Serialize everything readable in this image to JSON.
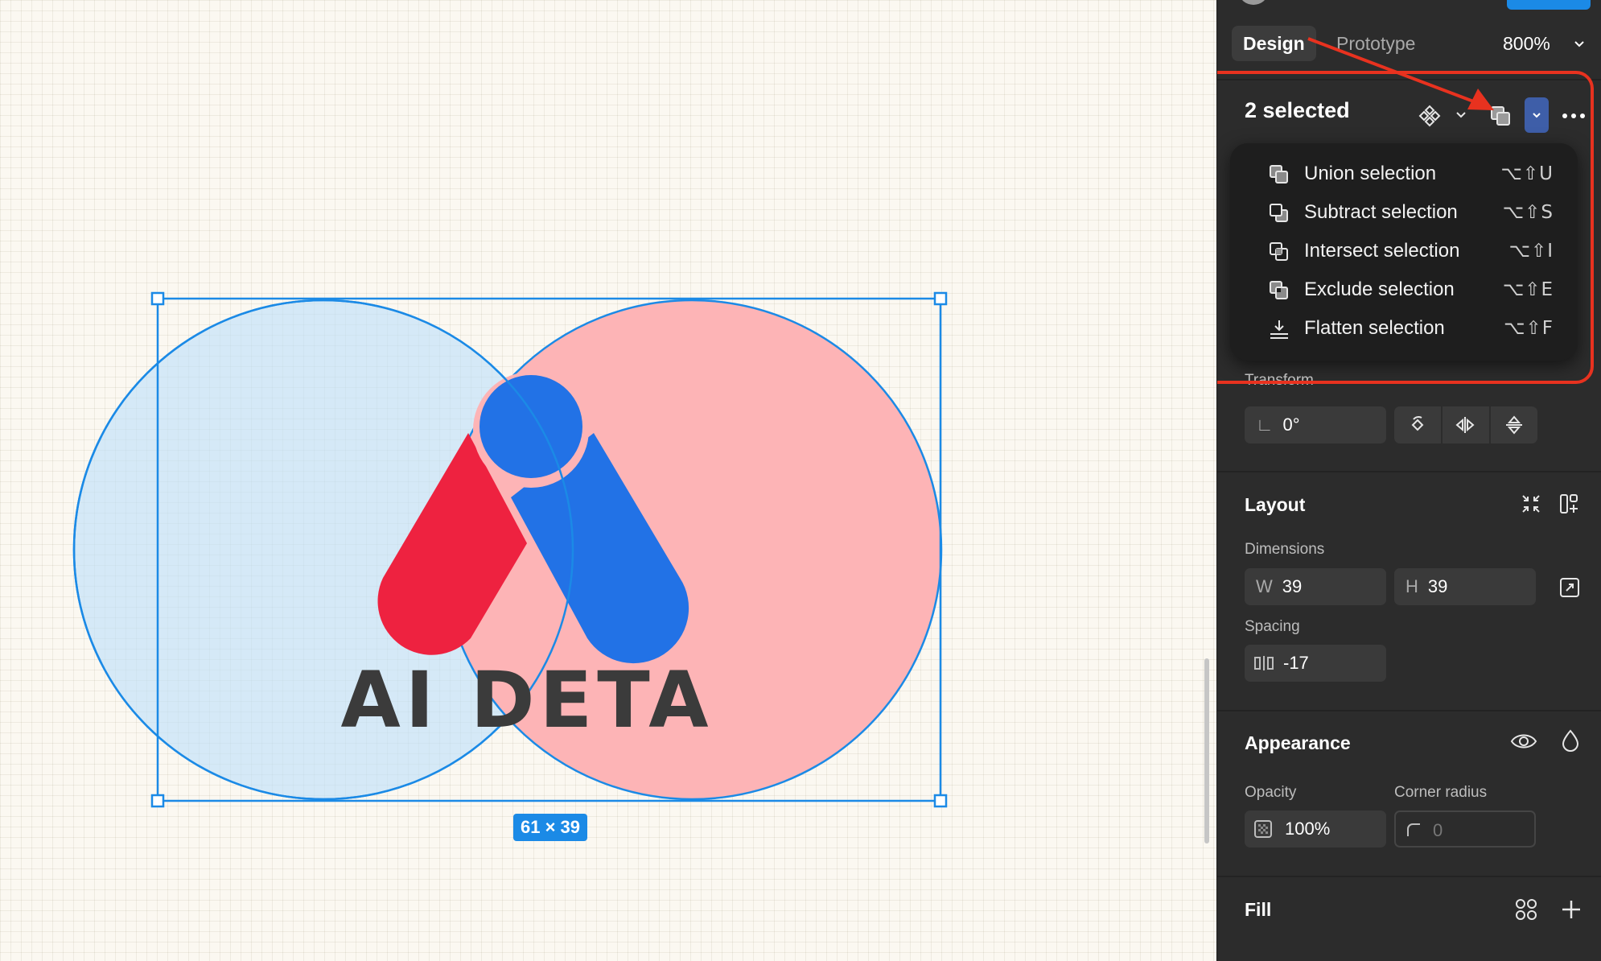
{
  "canvas": {
    "logo_text": "AI DETA",
    "selection_size": "61 × 39",
    "colors": {
      "background": "#fbf8f1",
      "left_circle_fill": "#d3ebfb",
      "right_circle_fill": "#fdb4b6",
      "selection": "#1b8ae6",
      "logo_red": "#ee2240",
      "logo_blue": "#2272e6",
      "logo_text": "#3b3b3b"
    }
  },
  "panel": {
    "tabs": {
      "design": "Design",
      "prototype": "Prototype"
    },
    "zoom": "800%",
    "selection_title": "2 selected",
    "boolean_menu": [
      {
        "label": "Union selection",
        "shortcut": "⌥⇧U",
        "icon": "union-icon"
      },
      {
        "label": "Subtract selection",
        "shortcut": "⌥⇧S",
        "icon": "subtract-icon"
      },
      {
        "label": "Intersect selection",
        "shortcut": "⌥⇧I",
        "icon": "intersect-icon"
      },
      {
        "label": "Exclude selection",
        "shortcut": "⌥⇧E",
        "icon": "exclude-icon"
      },
      {
        "label": "Flatten selection",
        "shortcut": "⌥⇧F",
        "icon": "flatten-icon"
      }
    ],
    "transform": {
      "label": "Transform",
      "rotation": "0°"
    },
    "layout": {
      "title": "Layout",
      "dimensions_label": "Dimensions",
      "width_prefix": "W",
      "width": "39",
      "height_prefix": "H",
      "height": "39",
      "spacing_label": "Spacing",
      "spacing": "-17"
    },
    "appearance": {
      "title": "Appearance",
      "opacity_label": "Opacity",
      "opacity": "100%",
      "corner_radius_label": "Corner radius",
      "corner_radius": "0"
    },
    "fill": {
      "title": "Fill"
    },
    "annotation_color": "#e8321f"
  }
}
